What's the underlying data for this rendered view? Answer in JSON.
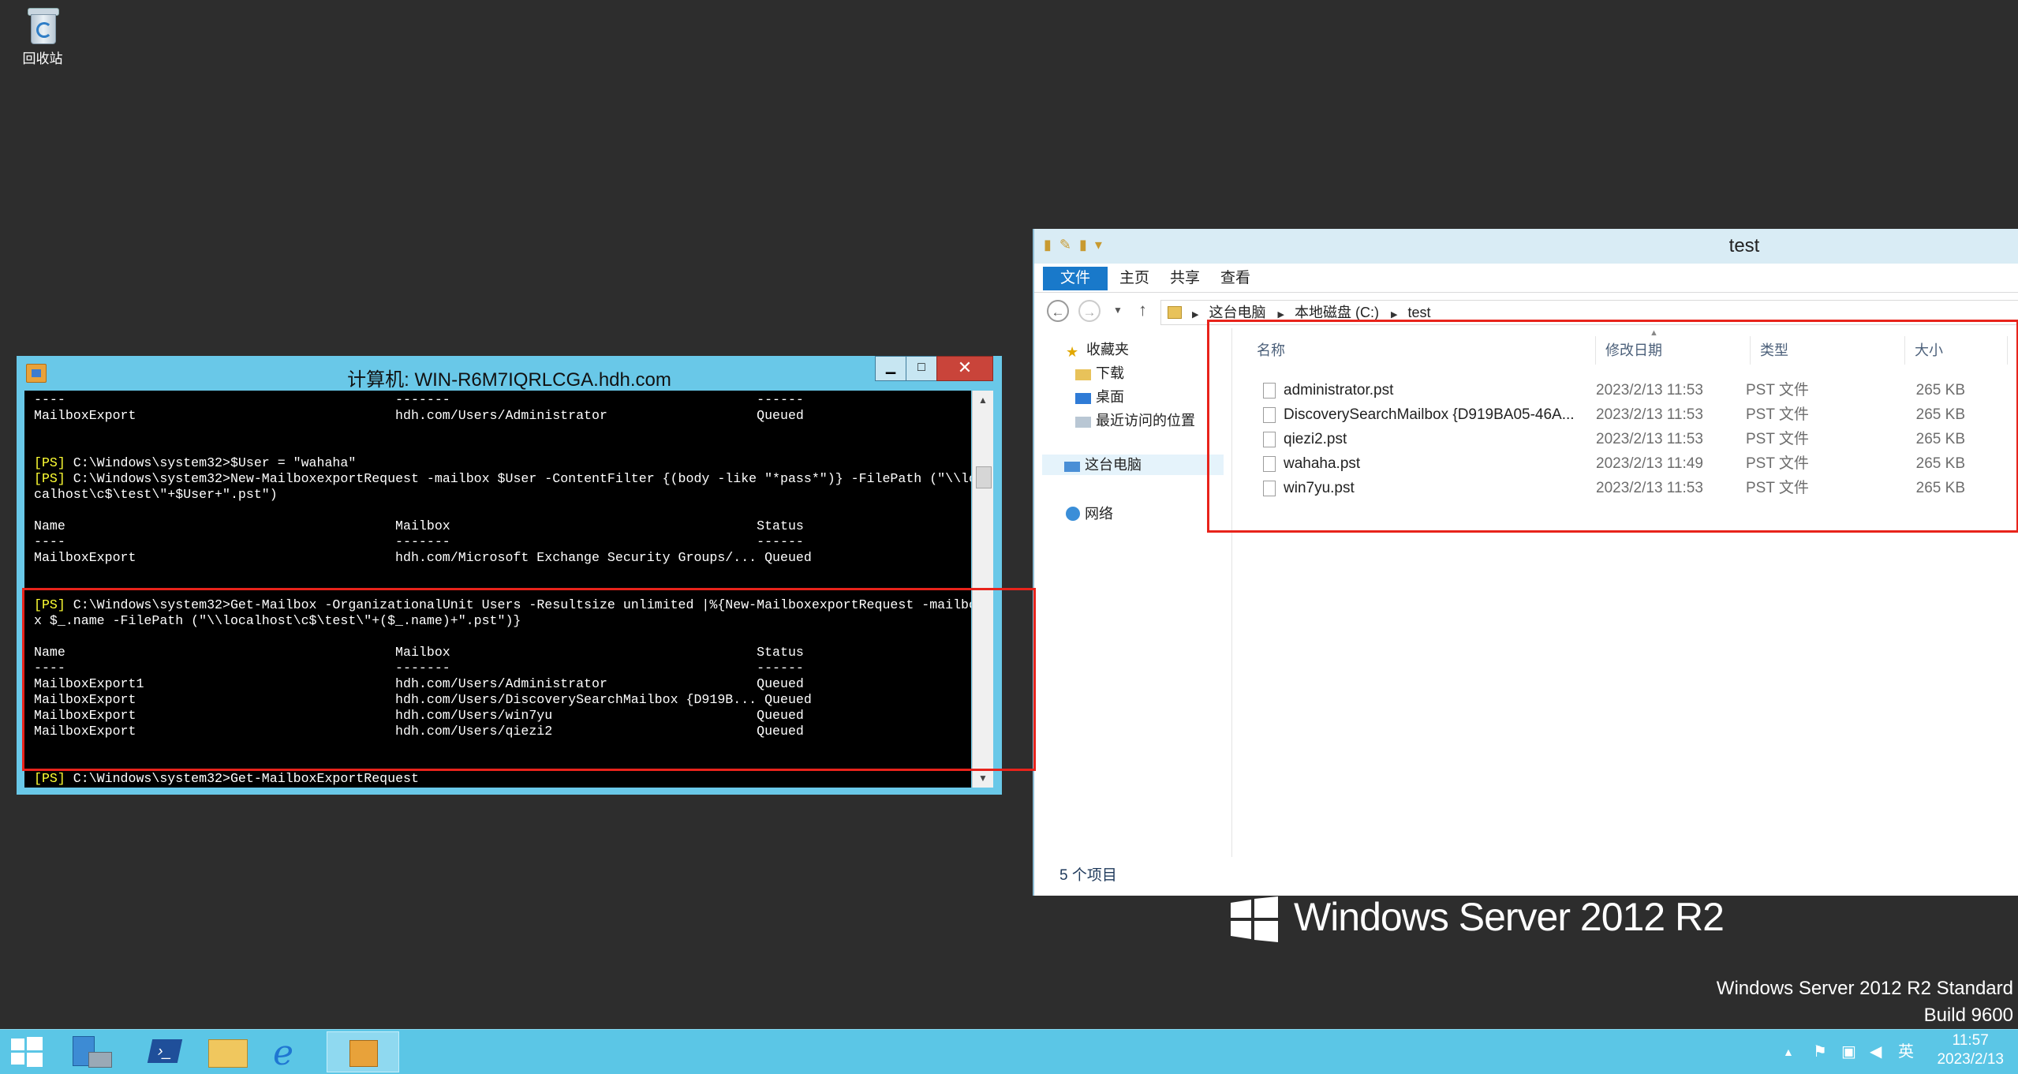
{
  "desktop": {
    "recycle_bin_label": "回收站"
  },
  "powershell": {
    "title": "计算机: WIN-R6M7IQRLCGA.hdh.com",
    "min_glyph": "▁",
    "max_glyph": "□",
    "close_glyph": "✕",
    "lines": [
      {
        "prompt": "",
        "text": "----                                          -------                                       ------"
      },
      {
        "prompt": "",
        "text": "MailboxExport                                 hdh.com/Users/Administrator                   Queued"
      },
      {
        "prompt": "",
        "text": ""
      },
      {
        "prompt": "",
        "text": ""
      },
      {
        "prompt": "[PS]",
        "text": " C:\\Windows\\system32>$User = \"wahaha\""
      },
      {
        "prompt": "[PS]",
        "text": " C:\\Windows\\system32>New-MailboxexportRequest -mailbox $User -ContentFilter {(body -like \"*pass*\")} -FilePath (\"\\\\lo"
      },
      {
        "prompt": "",
        "text": "calhost\\c$\\test\\\"+$User+\".pst\")"
      },
      {
        "prompt": "",
        "text": ""
      },
      {
        "prompt": "",
        "text": "Name                                          Mailbox                                       Status"
      },
      {
        "prompt": "",
        "text": "----                                          -------                                       ------"
      },
      {
        "prompt": "",
        "text": "MailboxExport                                 hdh.com/Microsoft Exchange Security Groups/... Queued"
      },
      {
        "prompt": "",
        "text": ""
      },
      {
        "prompt": "",
        "text": ""
      },
      {
        "prompt": "[PS]",
        "text": " C:\\Windows\\system32>Get-Mailbox -OrganizationalUnit Users -Resultsize unlimited |%{New-MailboxexportRequest -mailbo"
      },
      {
        "prompt": "",
        "text": "x $_.name -FilePath (\"\\\\localhost\\c$\\test\\\"+($_.name)+\".pst\")}"
      },
      {
        "prompt": "",
        "text": ""
      },
      {
        "prompt": "",
        "text": "Name                                          Mailbox                                       Status"
      },
      {
        "prompt": "",
        "text": "----                                          -------                                       ------"
      },
      {
        "prompt": "",
        "text": "MailboxExport1                                hdh.com/Users/Administrator                   Queued"
      },
      {
        "prompt": "",
        "text": "MailboxExport                                 hdh.com/Users/DiscoverySearchMailbox {D919B... Queued"
      },
      {
        "prompt": "",
        "text": "MailboxExport                                 hdh.com/Users/win7yu                          Queued"
      },
      {
        "prompt": "",
        "text": "MailboxExport                                 hdh.com/Users/qiezi2                          Queued"
      },
      {
        "prompt": "",
        "text": ""
      },
      {
        "prompt": "",
        "text": ""
      },
      {
        "prompt": "[PS]",
        "text": " C:\\Windows\\system32>Get-MailboxExportRequest"
      }
    ]
  },
  "explorer": {
    "title": "test",
    "ribbon_tabs": [
      "文件",
      "主页",
      "共享",
      "查看"
    ],
    "breadcrumb": [
      "这台电脑",
      "本地磁盘 (C:)",
      "test"
    ],
    "nav": {
      "favorites": "收藏夹",
      "downloads": "下载",
      "desktop": "桌面",
      "recent": "最近访问的位置",
      "this_pc": "这台电脑",
      "network": "网络"
    },
    "columns": [
      "名称",
      "修改日期",
      "类型",
      "大小"
    ],
    "files": [
      {
        "name": "administrator.pst",
        "date": "2023/2/13 11:53",
        "type": "PST 文件",
        "size": "265 KB"
      },
      {
        "name": "DiscoverySearchMailbox {D919BA05-46A...",
        "date": "2023/2/13 11:53",
        "type": "PST 文件",
        "size": "265 KB"
      },
      {
        "name": "qiezi2.pst",
        "date": "2023/2/13 11:53",
        "type": "PST 文件",
        "size": "265 KB"
      },
      {
        "name": "wahaha.pst",
        "date": "2023/2/13 11:49",
        "type": "PST 文件",
        "size": "265 KB"
      },
      {
        "name": "win7yu.pst",
        "date": "2023/2/13 11:53",
        "type": "PST 文件",
        "size": "265 KB"
      }
    ],
    "status": "5 个项目"
  },
  "branding": {
    "product": "Windows Server 2012 R2",
    "edition": "Windows Server 2012 R2 Standard",
    "build": "Build 9600"
  },
  "taskbar": {
    "ime": "英",
    "time": "11:57",
    "date": "2023/2/13"
  },
  "colors": {
    "highlight_box": "#e8231b",
    "taskbar": "#5bc6e6",
    "ps_prompt": "#ffff33"
  }
}
